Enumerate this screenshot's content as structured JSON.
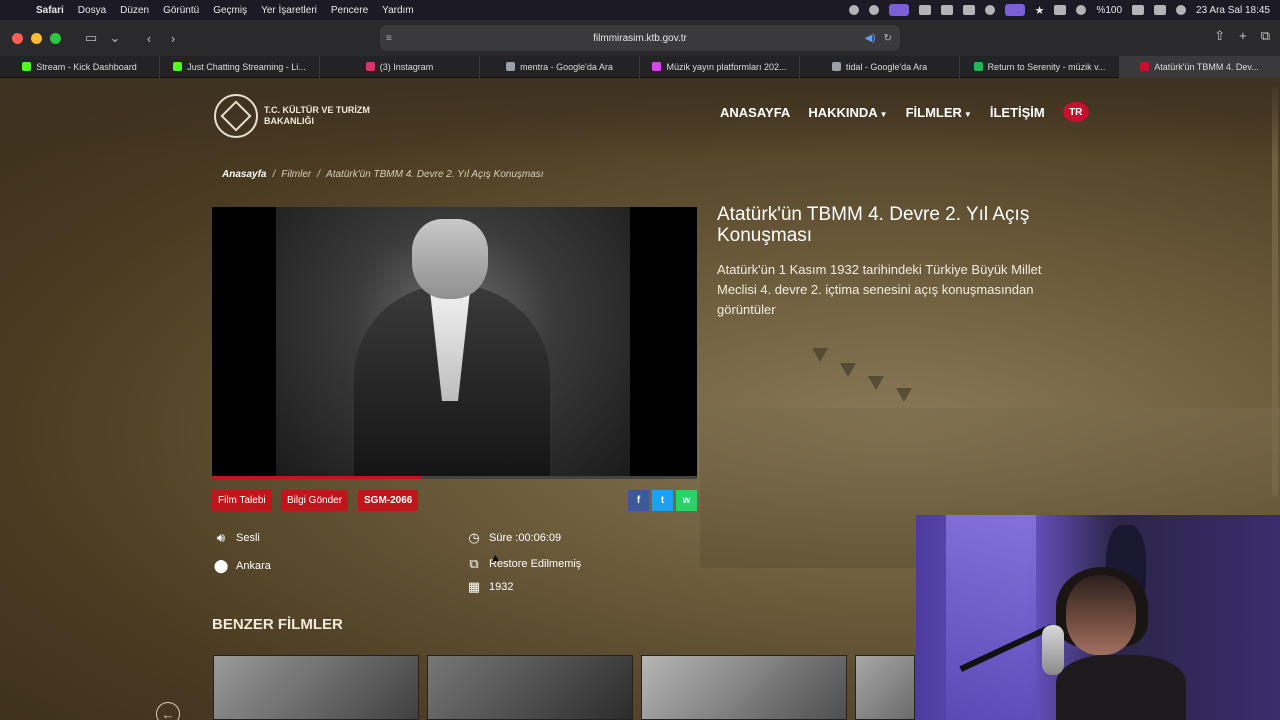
{
  "menubar": {
    "app_name": "Safari",
    "items": [
      "Dosya",
      "Düzen",
      "Görüntü",
      "Geçmiş",
      "Yer İşaretleri",
      "Pencere",
      "Yardım"
    ],
    "battery": "%100",
    "clock": "23 Ara Sal  18:45"
  },
  "toolbar": {
    "url": "filmmirasim.ktb.gov.tr"
  },
  "tabs": [
    {
      "label": "Stream - Kick Dashboard",
      "color": "#53fc18"
    },
    {
      "label": "Just Chatting Streaming - Li...",
      "color": "#53fc18"
    },
    {
      "label": "(3) Instagram",
      "color": "#e1306c"
    },
    {
      "label": "mentra - Google'da Ara",
      "color": "#9aa0a6"
    },
    {
      "label": "Müzik yayın platformları 202...",
      "color": "#d946ef"
    },
    {
      "label": "tidal - Google'da Ara",
      "color": "#9aa0a6"
    },
    {
      "label": "Return to Serenity - müzik v...",
      "color": "#1db954"
    },
    {
      "label": "Atatürk'ün TBMM 4. Dev...",
      "color": "#c8102e"
    }
  ],
  "site": {
    "logo_line1": "T.C. KÜLTÜR VE TURİZM",
    "logo_line2": "BAKANLIĞI",
    "nav": {
      "home": "ANASAYFA",
      "about": "HAKKINDA",
      "films": "FİLMLER",
      "contact": "İLETİŞİM",
      "lang": "TR"
    },
    "breadcrumb": {
      "home": "Anasayfa",
      "films": "Filmler",
      "current": "Atatürk'ün TBMM 4. Devre 2. Yıl Açış Konuşması"
    }
  },
  "film": {
    "title": "Atatürk'ün TBMM 4. Devre 2. Yıl Açış Konuşması",
    "description": "Atatürk'ün 1 Kasım 1932 tarihindeki Türkiye Büyük Millet Meclisi 4. devre 2. içtima senesini açış konuşmasından görüntüler",
    "progress": 0.43,
    "buttons": {
      "request": "Film Talebi",
      "info": "Bilgi Gönder",
      "code": "SGM-2066"
    },
    "social": {
      "facebook": "f",
      "twitter": "t",
      "whatsapp": "w"
    },
    "meta": {
      "sound": "Sesli",
      "location": "Ankara",
      "duration": "Süre :00:06:09",
      "restore": "Restore Edilmemiş",
      "year": "1932"
    }
  },
  "similar": {
    "title": "BENZER FİLMLER"
  },
  "colors": {
    "accent": "#c0161b",
    "facebook": "#3b5998",
    "twitter": "#1da1f2",
    "whatsapp": "#25d366"
  }
}
